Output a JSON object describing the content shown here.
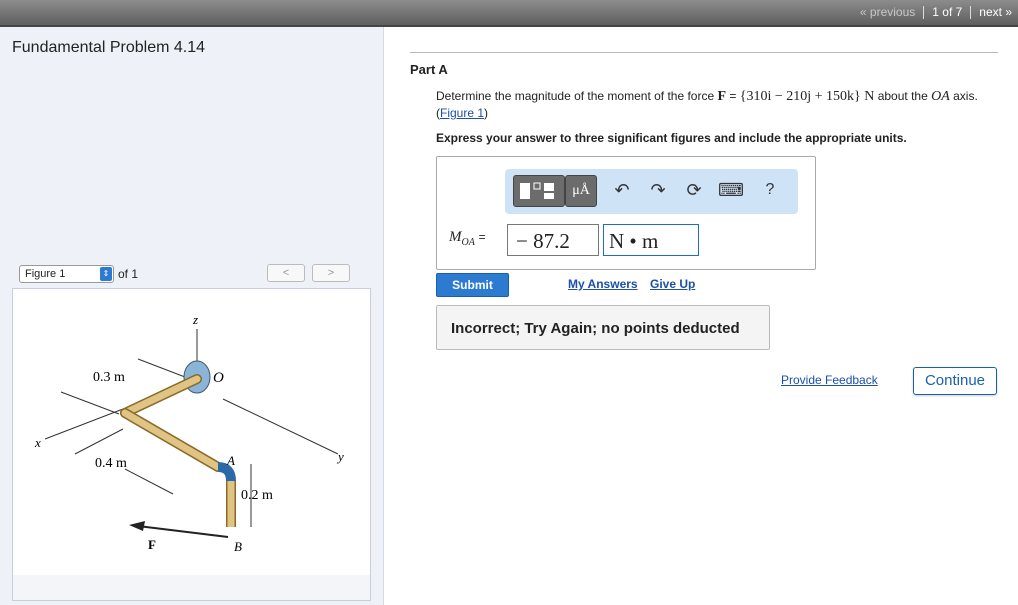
{
  "nav": {
    "previous": "« previous",
    "position": "1 of 7",
    "next": "next »"
  },
  "problem": {
    "title": "Fundamental Problem 4.14"
  },
  "figure_nav": {
    "selected": "Figure 1",
    "of_label": "of 1",
    "prev": "<",
    "next": ">"
  },
  "figure": {
    "labels": {
      "z": "z",
      "x": "x",
      "y": "y",
      "O": "O",
      "A": "A",
      "B": "B",
      "F": "F",
      "dim1": "0.3 m",
      "dim2": "0.4 m",
      "dim3": "0.2 m"
    }
  },
  "part": {
    "title": "Part A"
  },
  "question": {
    "prefix": "Determine the magnitude of the moment of the force",
    "force_symbol": "F",
    "eq": " = ",
    "force_expr": "{310i − 210j + 150k} N",
    "middle": " about the ",
    "axis": "OA",
    "suffix": " axis. (",
    "figure_link": "Figure 1",
    "close": ")"
  },
  "instructions": "Express your answer to three significant figures and include the appropriate units.",
  "toolbar": {
    "units_label": "μÅ",
    "icons": [
      "templates-icon",
      "units-icon",
      "undo-icon",
      "redo-icon",
      "reset-icon",
      "keyboard-icon",
      "help-icon"
    ],
    "help_label": "?"
  },
  "answer": {
    "variable": "M",
    "subscript": "OA",
    "equals": "=",
    "value": "− 87.2",
    "unit": "N • m"
  },
  "buttons": {
    "submit": "Submit",
    "my_answers": "My Answers",
    "give_up": "Give Up",
    "continue": "Continue"
  },
  "feedback_message": "Incorrect; Try Again; no points deducted",
  "provide_feedback": "Provide Feedback",
  "colors": {
    "accent": "#2d7bd1",
    "link": "#1b4fa8",
    "toolbar_bg": "#cfe3f7",
    "left_panel_bg": "#eef2f8"
  }
}
